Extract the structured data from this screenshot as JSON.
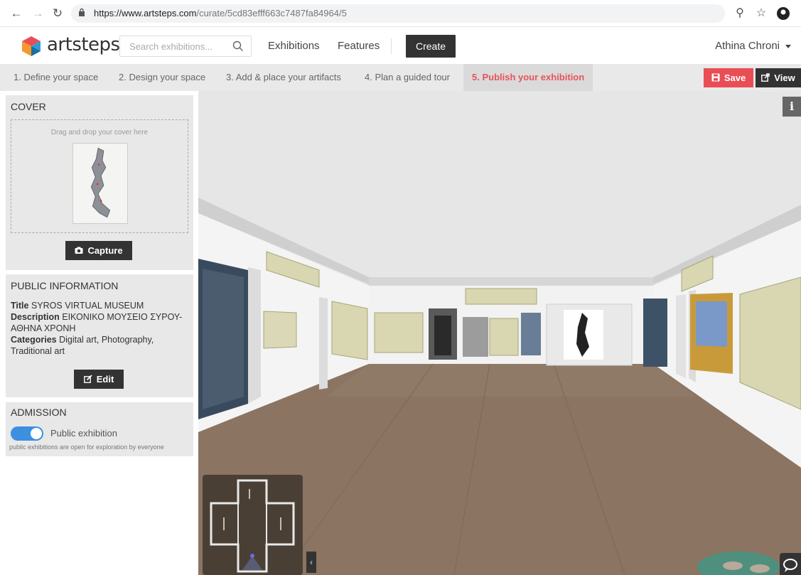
{
  "browser": {
    "url_host": "https://www.artsteps.com",
    "url_path": "/curate/5cd83efff663c7487fa84964/5"
  },
  "header": {
    "logo_text": "artsteps",
    "search_placeholder": "Search exhibitions...",
    "nav_exhibitions": "Exhibitions",
    "nav_features": "Features",
    "create_label": "Create",
    "user_name": "Athina Chroni"
  },
  "steps": {
    "step1": "1. Define your space",
    "step2": "2. Design your space",
    "step3": "3. Add & place your artifacts",
    "step4": "4. Plan a guided tour",
    "step5": "5. Publish your exhibition",
    "save_label": "Save",
    "view_label": "View"
  },
  "cover": {
    "title": "COVER",
    "drop_text": "Drag and drop your cover here",
    "capture_label": "Capture"
  },
  "public_info": {
    "title": "PUBLIC INFORMATION",
    "title_label": "Title",
    "title_value": "SYROS VIRTUAL MUSEUM",
    "description_label": "Description",
    "description_value": "ΕΙΚΟΝΙΚΟ ΜΟΥΣΕΙΟ ΣΥΡΟΥ- ΑΘΗΝΑ ΧΡΟΝΗ",
    "categories_label": "Categories",
    "categories_value": "Digital art, Photography, Traditional art",
    "edit_label": "Edit"
  },
  "admission": {
    "title": "ADMISSION",
    "toggle_label": "Public exhibition",
    "description": "public exhibitions are open for exploration by everyone",
    "public": true
  },
  "viewport": {
    "info_icon": "i",
    "collapse_icon": "‹"
  },
  "colors": {
    "accent_red": "#e94e55",
    "toggle_blue": "#3d8fe0",
    "dark_button": "#333333"
  }
}
